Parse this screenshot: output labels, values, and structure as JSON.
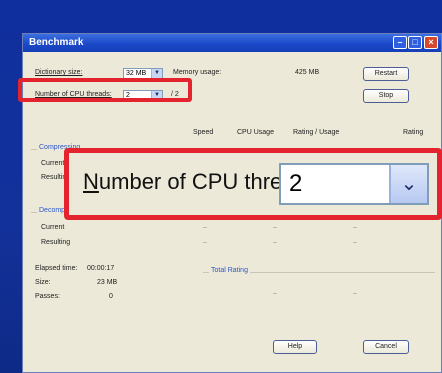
{
  "window": {
    "title": "Benchmark",
    "controls": {
      "minimize": "–",
      "maximize": "□",
      "close": "×"
    }
  },
  "settings": {
    "dictionary_label": "Dictionary size:",
    "dictionary_value": "32 MB",
    "memory_label": "Memory usage:",
    "memory_value": "425 MB",
    "threads_label": "Number of CPU threads:",
    "threads_value": "2",
    "threads_max": "/ 2"
  },
  "buttons": {
    "restart": "Restart",
    "stop": "Stop",
    "help": "Help",
    "cancel": "Cancel"
  },
  "columns": [
    "Speed",
    "CPU Usage",
    "Rating / Usage",
    "Rating"
  ],
  "compressing": {
    "title": "Compressing",
    "rows": [
      "Current",
      "Resulting"
    ]
  },
  "decompressing": {
    "title": "Decompressing",
    "rows": [
      "Current",
      "Resulting"
    ]
  },
  "stats": {
    "elapsed_label": "Elapsed time:",
    "elapsed_value": "00:00:17",
    "size_label": "Size:",
    "size_value": "23 MB",
    "passes_label": "Passes:",
    "passes_value": "0"
  },
  "total_rating": {
    "title": "Total Rating"
  },
  "zoom": {
    "label_prefix": "N",
    "label_rest": "umber of CPU threads:",
    "value": "2",
    "arrow": "⌄"
  },
  "colors": {
    "highlight": "#e3232d",
    "background": "#13319a"
  }
}
